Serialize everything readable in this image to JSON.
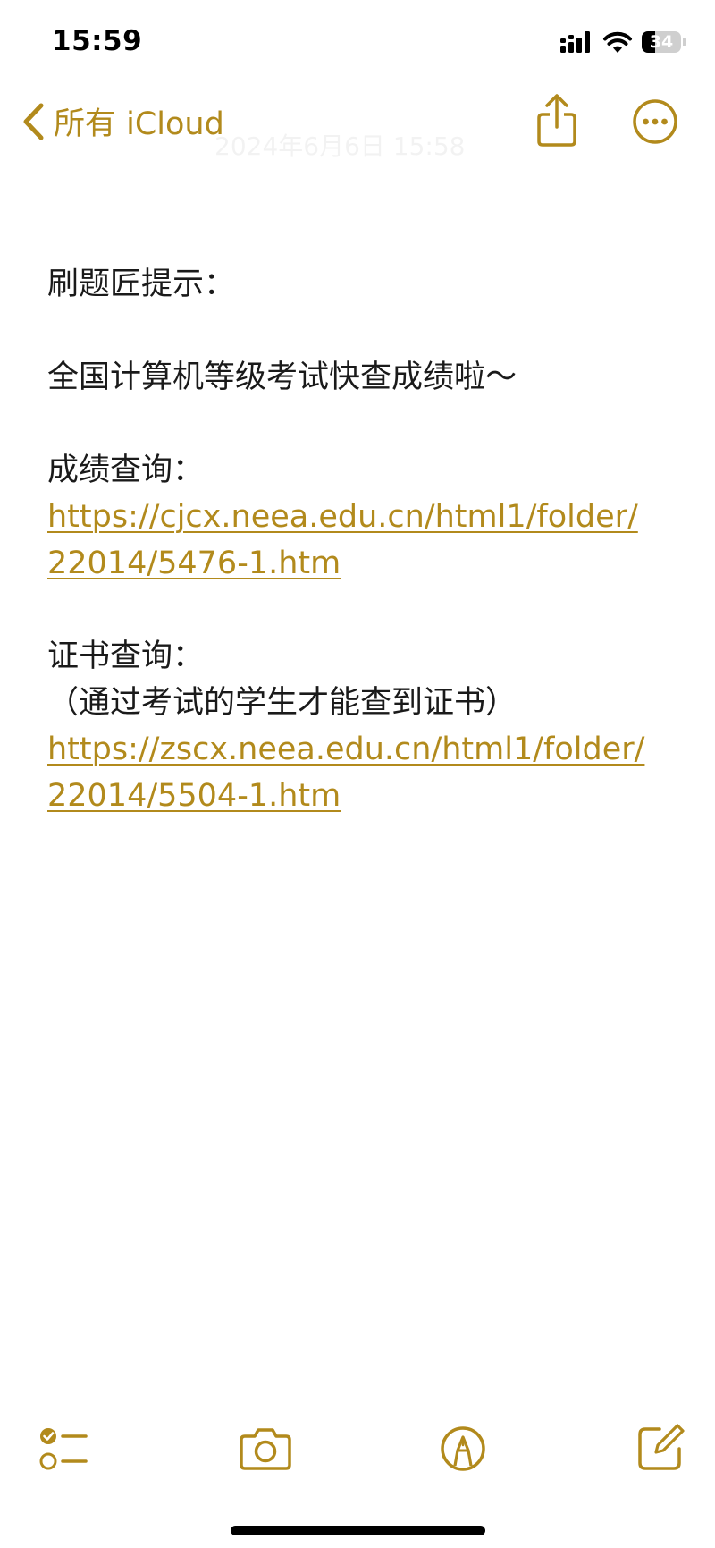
{
  "status_bar": {
    "time": "15:59",
    "battery_level": "34",
    "battery_fraction": 0.34
  },
  "nav": {
    "back_label": "所有 iCloud",
    "faded_date": "2024年6月6日 15:58",
    "share_icon": "share-icon",
    "more_icon": "ellipsis-circle-icon"
  },
  "note": {
    "title": "刷题匠提示：",
    "line_1": "全国计算机等级考试快查成绩啦～",
    "score_label": "成绩查询：",
    "score_link_1": "https://cjcx.neea.edu.cn/html1/folder/",
    "score_link_2": "22014/5476-1.htm",
    "cert_label": "证书查询：",
    "cert_note": "（通过考试的学生才能查到证书）",
    "cert_link_1": "https://zscx.neea.edu.cn/html1/folder/",
    "cert_link_2": "22014/5504-1.htm"
  },
  "toolbar": {
    "checklist_icon": "checklist-icon",
    "camera_icon": "camera-icon",
    "markup_icon": "markup-pen-icon",
    "compose_icon": "compose-icon"
  },
  "colors": {
    "accent": "#b28a1c",
    "text": "#1a1a1a",
    "background": "#ffffff"
  }
}
